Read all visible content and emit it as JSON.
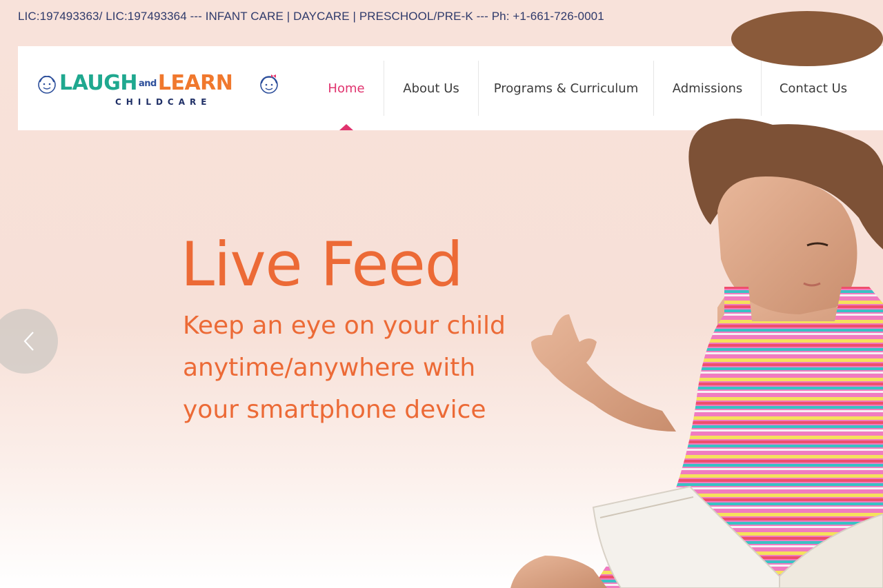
{
  "topbar": {
    "text": "LIC:197493363/ LIC:197493364 --- INFANT CARE | DAYCARE | PRESCHOOL/PRE-K --- Ph: +1-661-726-0001"
  },
  "logo": {
    "word_laugh": "LAUGH",
    "word_and": "and",
    "word_learn": "LEARN",
    "subtitle": "CHILDCARE"
  },
  "nav": {
    "items": [
      {
        "label": "Home",
        "active": true
      },
      {
        "label": "About Us"
      },
      {
        "label": "Programs & Curriculum"
      },
      {
        "label": "Admissions"
      },
      {
        "label": "Contact Us"
      }
    ]
  },
  "hero": {
    "title": "Live Feed",
    "subtitle": "Keep an eye on your child anytime/anywhere with your smartphone device"
  },
  "icons": {
    "prev": "chevron-left-icon",
    "logo_faces": "child-face-icon"
  },
  "colors": {
    "accent_pink": "#e0336e",
    "hero_orange": "#ec6a36",
    "topbar_navy": "#2f3a6b",
    "background_peach": "#f8e2da"
  }
}
